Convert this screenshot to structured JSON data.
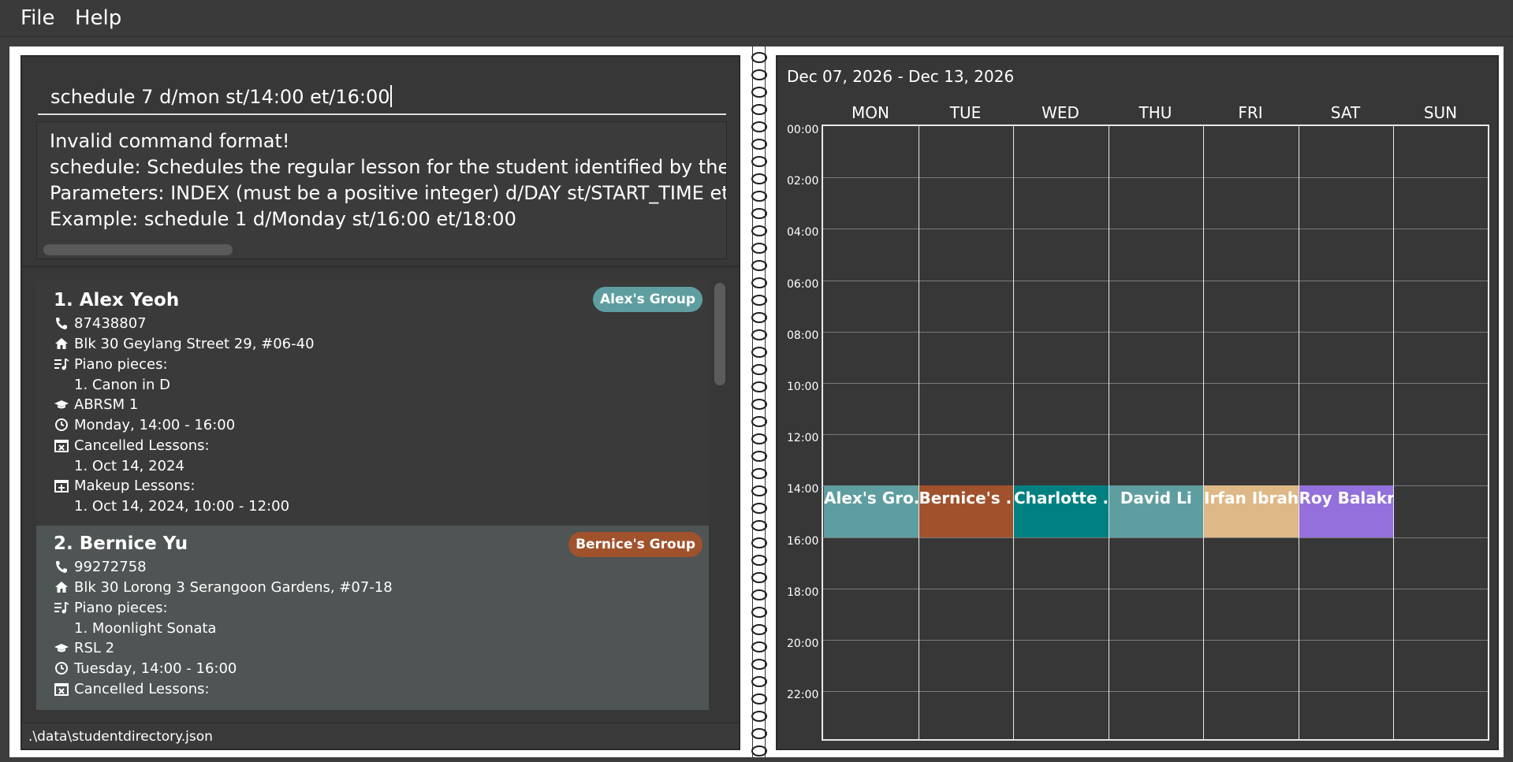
{
  "menu": {
    "file": "File",
    "help": "Help"
  },
  "command": {
    "value": "schedule 7 d/mon st/14:00 et/16:00"
  },
  "result": {
    "lines": [
      "Invalid command format!",
      "schedule: Schedules the regular lesson for the student identified by the ind",
      "Parameters: INDEX (must be a positive integer) d/DAY st/START_TIME et/EI",
      "Example: schedule 1 d/Monday st/16:00 et/18:00"
    ]
  },
  "students": [
    {
      "name": "1. Alex Yeoh",
      "tag": "Alex's Group",
      "tag_color": "#5f9ea0",
      "phone": "87438807",
      "address": "Blk 30 Geylang Street 29, #06-40",
      "pieces_label": "Piano pieces:",
      "pieces": [
        "1. Canon in D"
      ],
      "grade": "ABRSM 1",
      "lesson_time": "Monday, 14:00 - 16:00",
      "cancelled_label": "Cancelled Lessons:",
      "cancelled": [
        "1. Oct 14, 2024"
      ],
      "makeup_label": "Makeup Lessons:",
      "makeup": [
        "1. Oct 14, 2024, 10:00 - 12:00"
      ]
    },
    {
      "name": "2. Bernice Yu",
      "tag": "Bernice's Group",
      "tag_color": "#a0522d",
      "phone": "99272758",
      "address": "Blk 30 Lorong 3 Serangoon Gardens, #07-18",
      "pieces_label": "Piano pieces:",
      "pieces": [
        "1. Moonlight Sonata"
      ],
      "grade": "RSL 2",
      "lesson_time": "Tuesday, 14:00 - 16:00",
      "cancelled_label": "Cancelled Lessons:"
    }
  ],
  "status": {
    "path": ".\\data\\studentdirectory.json"
  },
  "calendar": {
    "date_range": "Dec 07, 2026 - Dec 13, 2026",
    "days": [
      "MON",
      "TUE",
      "WED",
      "THU",
      "FRI",
      "SAT",
      "SUN"
    ],
    "times": [
      "00:00",
      "02:00",
      "04:00",
      "06:00",
      "08:00",
      "10:00",
      "12:00",
      "14:00",
      "16:00",
      "18:00",
      "20:00",
      "22:00"
    ],
    "lessons": [
      {
        "day": 0,
        "start": 14,
        "end": 16,
        "label": "Alex's Gro...",
        "color": "#5f9ea0"
      },
      {
        "day": 1,
        "start": 14,
        "end": 16,
        "label": "Bernice's ...",
        "color": "#a0522d"
      },
      {
        "day": 2,
        "start": 14,
        "end": 16,
        "label": "Charlotte ...",
        "color": "#008080"
      },
      {
        "day": 3,
        "start": 14,
        "end": 16,
        "label": "David Li",
        "color": "#5f9ea0"
      },
      {
        "day": 4,
        "start": 14,
        "end": 16,
        "label": "Irfan Ibrah...",
        "color": "#deb887"
      },
      {
        "day": 5,
        "start": 14,
        "end": 16,
        "label": "Roy Balakr...",
        "color": "#9370db"
      }
    ]
  }
}
